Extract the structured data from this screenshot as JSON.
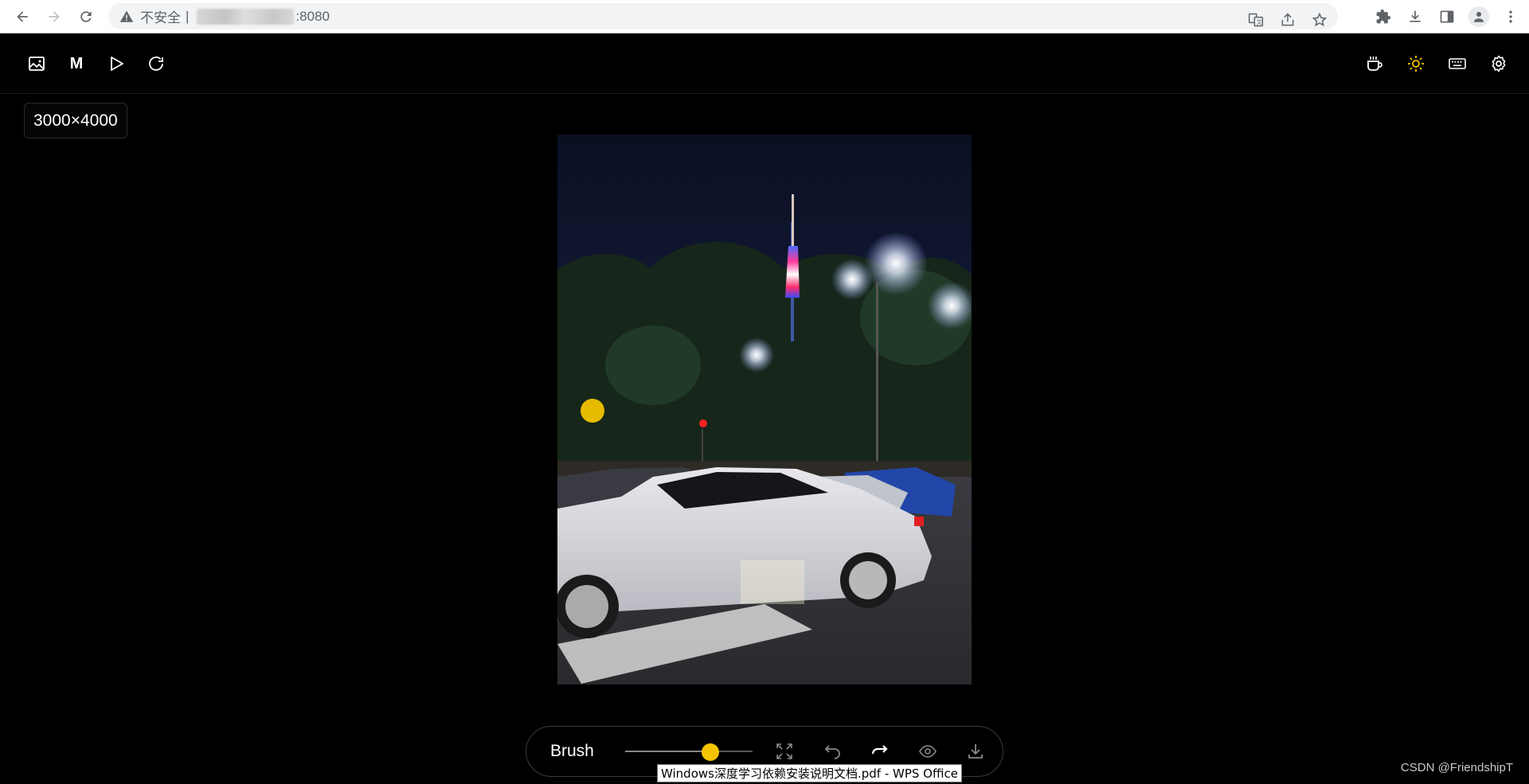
{
  "browser": {
    "insecure_label": "不安全",
    "separator": "|",
    "url_suffix": ":8080"
  },
  "app": {
    "header_left": {
      "mask_label": "M"
    },
    "image_size": "3000×4000"
  },
  "toolbar": {
    "brush_label": "Brush",
    "brush_size_fraction": 0.67
  },
  "tooltip": "Windows深度学习依赖安装说明文档.pdf - WPS Office",
  "watermark": "CSDN @FriendshipT",
  "colors": {
    "accent": "#f5c400",
    "background": "#000000"
  }
}
